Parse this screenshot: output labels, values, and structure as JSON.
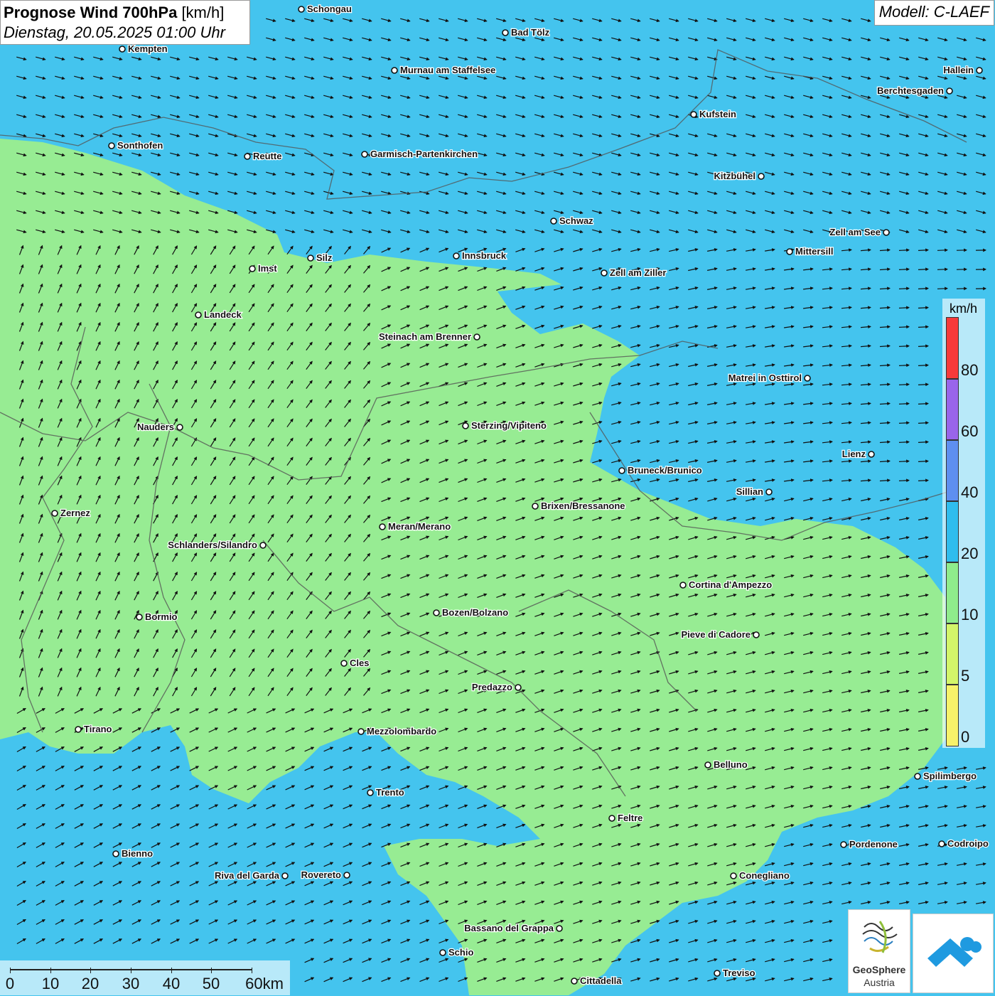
{
  "header": {
    "title_bold": "Prognose Wind 700hPa",
    "title_unit": "[km/h]",
    "date": "Dienstag, 20.05.2025 01:00 Uhr",
    "model": "Modell: C-LAEF"
  },
  "legend": {
    "unit": "km/h",
    "levels": [
      {
        "label": "80",
        "color": "#f73a3a"
      },
      {
        "label": "60",
        "color": "#9965ea"
      },
      {
        "label": "40",
        "color": "#5e8ff0"
      },
      {
        "label": "20",
        "color": "#2fbdee"
      },
      {
        "label": "10",
        "color": "#8fec8c"
      },
      {
        "label": "5",
        "color": "#d3f56a"
      },
      {
        "label": "0",
        "color": "#f7f26a"
      }
    ]
  },
  "scale": {
    "labels": [
      "0",
      "10",
      "20",
      "30",
      "40",
      "50",
      "60km"
    ]
  },
  "branding": {
    "logo_text_1": "GeoSphere",
    "logo_text_2": "Austria"
  },
  "cities": [
    {
      "name": "Schongau"
    },
    {
      "name": "Bad Tölz"
    },
    {
      "name": "Kempten"
    },
    {
      "name": "Murnau am Staffelsee"
    },
    {
      "name": "Hallein"
    },
    {
      "name": "Berchtesgaden"
    },
    {
      "name": "Kufstein"
    },
    {
      "name": "Sonthofen"
    },
    {
      "name": "Reutte"
    },
    {
      "name": "Garmisch-Partenkirchen"
    },
    {
      "name": "Kitzbühel"
    },
    {
      "name": "Schwaz"
    },
    {
      "name": "Zell am See"
    },
    {
      "name": "Mittersill"
    },
    {
      "name": "Innsbruck"
    },
    {
      "name": "Imst"
    },
    {
      "name": "Silz"
    },
    {
      "name": "Zell am Ziller"
    },
    {
      "name": "Landeck"
    },
    {
      "name": "Steinach am Brenner"
    },
    {
      "name": "Matrei in Osttirol"
    },
    {
      "name": "Nauders"
    },
    {
      "name": "Sterzing/Vipiteno"
    },
    {
      "name": "Lienz"
    },
    {
      "name": "Bruneck/Brunico"
    },
    {
      "name": "Sillian"
    },
    {
      "name": "Zernez"
    },
    {
      "name": "Brixen/Bressanone"
    },
    {
      "name": "Meran/Merano"
    },
    {
      "name": "Schlanders/Silandro"
    },
    {
      "name": "Cortina d'Ampezzo"
    },
    {
      "name": "Bozen/Bolzano"
    },
    {
      "name": "Bormio"
    },
    {
      "name": "Pieve di Cadore"
    },
    {
      "name": "Cles"
    },
    {
      "name": "Predazzo"
    },
    {
      "name": "Tirano"
    },
    {
      "name": "Mezzolombardo"
    },
    {
      "name": "Belluno"
    },
    {
      "name": "Spilimbergo"
    },
    {
      "name": "Trento"
    },
    {
      "name": "Feltre"
    },
    {
      "name": "Pordenone"
    },
    {
      "name": "Codroipo"
    },
    {
      "name": "Bienno"
    },
    {
      "name": "Riva del Garda"
    },
    {
      "name": "Rovereto"
    },
    {
      "name": "Conegliano"
    },
    {
      "name": "Bassano del Grappa"
    },
    {
      "name": "Schio"
    },
    {
      "name": "Treviso"
    },
    {
      "name": "Cittadella"
    }
  ]
}
